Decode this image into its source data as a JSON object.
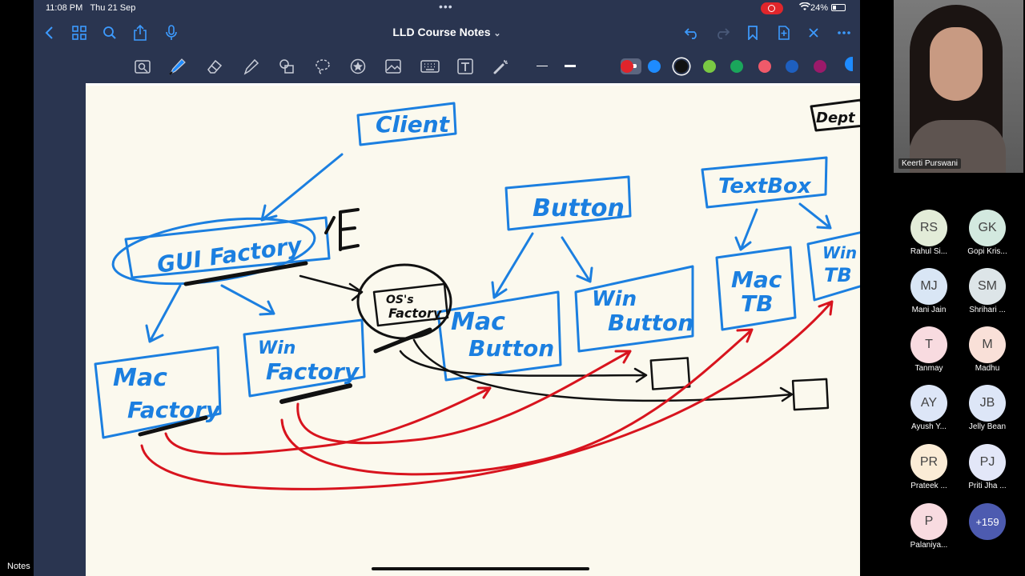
{
  "status_bar": {
    "time": "11:08 PM",
    "date": "Thu 21 Sep",
    "battery": "24%"
  },
  "nav": {
    "title": "LLD Course Notes",
    "title_chevron": "⌄",
    "left_icons": [
      "back-icon",
      "grid-icon",
      "search-icon",
      "share-icon",
      "mic-icon"
    ],
    "right_icons": [
      "undo-icon",
      "redo-icon",
      "bookmark-icon",
      "add-page-icon",
      "close-icon",
      "more-icon"
    ]
  },
  "toolbar": {
    "tools": [
      "lasso-zoom-icon",
      "pen-icon",
      "eraser-icon",
      "highlighter-icon",
      "shapes-icon",
      "lasso-icon",
      "sticker-icon",
      "image-icon",
      "keyboard-icon",
      "text-icon",
      "laser-pointer-icon"
    ],
    "colors": [
      "#e0242b",
      "#1e8bff",
      "#111111",
      "#7ac943",
      "#1aa65b",
      "#f05a6a",
      "#1e5fbf",
      "#9b1a6a"
    ]
  },
  "whiteboard": {
    "labels": [
      "Client",
      "GUI Factory",
      "Button",
      "TextBox",
      "Mac Factory",
      "Win Factory",
      "OS's Factory",
      "Mac Button",
      "Win Button",
      "Mac TB",
      "Win TB",
      "E",
      "Dept"
    ]
  },
  "app_label": "Notes",
  "speaker": {
    "name": "Keerti Purswani"
  },
  "participants": [
    {
      "initials": "RS",
      "name": "Rahul Si...",
      "color": "#e3ecd8"
    },
    {
      "initials": "GK",
      "name": "Gopi Kris...",
      "color": "#d3e9df"
    },
    {
      "initials": "MJ",
      "name": "Mani Jain",
      "color": "#d9e6f5"
    },
    {
      "initials": "SM",
      "name": "Shrihari ...",
      "color": "#dde5e8"
    },
    {
      "initials": "T",
      "name": "Tanmay",
      "color": "#f8dbe0"
    },
    {
      "initials": "M",
      "name": "Madhu",
      "color": "#f9e0d8"
    },
    {
      "initials": "AY",
      "name": "Ayush Y...",
      "color": "#dde6f7"
    },
    {
      "initials": "JB",
      "name": "Jelly Bean",
      "color": "#dde6f7"
    },
    {
      "initials": "PR",
      "name": "Prateek ...",
      "color": "#fbecd6"
    },
    {
      "initials": "PJ",
      "name": "Priti Jha ...",
      "color": "#e3e7f8"
    },
    {
      "initials": "P",
      "name": "Palaniya...",
      "color": "#f8dbe0"
    }
  ],
  "more_participants": "+159",
  "more_color": "#4d5bb0"
}
